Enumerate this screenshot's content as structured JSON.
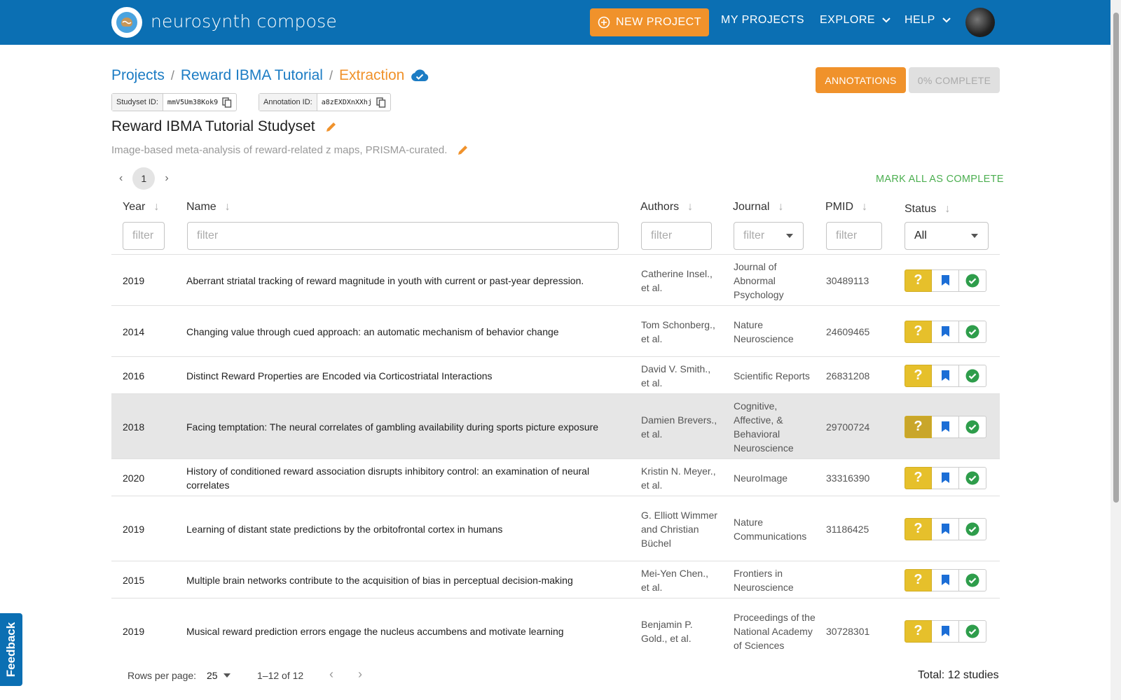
{
  "app": {
    "brand": "neurosynth compose",
    "new_project": "NEW PROJECT",
    "nav": [
      "MY PROJECTS",
      "EXPLORE",
      "HELP"
    ]
  },
  "breadcrumb": {
    "projects": "Projects",
    "project": "Reward IBMA Tutorial",
    "current": "Extraction"
  },
  "buttons": {
    "annotations": "ANNOTATIONS",
    "complete": "0% COMPLETE",
    "mark_all": "MARK ALL AS COMPLETE"
  },
  "ids": {
    "studyset_label": "Studyset ID:",
    "studyset_value": "mmV5Um38Kok9",
    "annotation_label": "Annotation ID:",
    "annotation_value": "a8zEXDXnXXhj"
  },
  "studyset": {
    "title": "Reward IBMA Tutorial Studyset",
    "description": "Image-based meta-analysis of reward-related z maps, PRISMA-curated."
  },
  "pager": {
    "page": "1"
  },
  "columns": {
    "year": "Year",
    "name": "Name",
    "authors": "Authors",
    "journal": "Journal",
    "pmid": "PMID",
    "status": "Status"
  },
  "filters": {
    "placeholder": "filter",
    "status_value": "All"
  },
  "rows": [
    {
      "year": "2019",
      "name": "Aberrant striatal tracking of reward magnitude in youth with current or past-year depression.",
      "authors": "Catherine Insel., et al.",
      "journal": "Journal of Abnormal Psychology",
      "pmid": "30489113"
    },
    {
      "year": "2014",
      "name": "Changing value through cued approach: an automatic mechanism of behavior change",
      "authors": "Tom Schonberg., et al.",
      "journal": "Nature Neuroscience",
      "pmid": "24609465"
    },
    {
      "year": "2016",
      "name": "Distinct Reward Properties are Encoded via Corticostriatal Interactions",
      "authors": "David V. Smith., et al.",
      "journal": "Scientific Reports",
      "pmid": "26831208"
    },
    {
      "year": "2018",
      "name": "Facing temptation: The neural correlates of gambling availability during sports picture exposure",
      "authors": "Damien Brevers., et al.",
      "journal": "Cognitive, Affective, & Behavioral Neuroscience",
      "pmid": "29700724"
    },
    {
      "year": "2020",
      "name": "History of conditioned reward association disrupts inhibitory control: an examination of neural correlates",
      "authors": "Kristin N. Meyer., et al.",
      "journal": "NeuroImage",
      "pmid": "33316390"
    },
    {
      "year": "2019",
      "name": "Learning of distant state predictions by the orbitofrontal cortex in humans",
      "authors": "G. Elliott Wimmer and Christian Büchel",
      "journal": "Nature Communications",
      "pmid": "31186425"
    },
    {
      "year": "2015",
      "name": "Multiple brain networks contribute to the acquisition of bias in perceptual decision-making",
      "authors": "Mei-Yen Chen., et al.",
      "journal": "Frontiers in Neuroscience",
      "pmid": ""
    },
    {
      "year": "2019",
      "name": "Musical reward prediction errors engage the nucleus accumbens and motivate learning",
      "authors": "Benjamin P. Gold., et al.",
      "journal": "Proceedings of the National Academy of Sciences",
      "pmid": "30728301"
    }
  ],
  "footer": {
    "rows_label": "Rows per page:",
    "rows_value": "25",
    "range": "1–12 of 12",
    "total": "Total: 12 studies"
  },
  "feedback": "Feedback",
  "colors": {
    "primary": "#0b6fb3",
    "accent": "#f0922b",
    "success": "#4caf50",
    "warning": "#e6c02b"
  }
}
